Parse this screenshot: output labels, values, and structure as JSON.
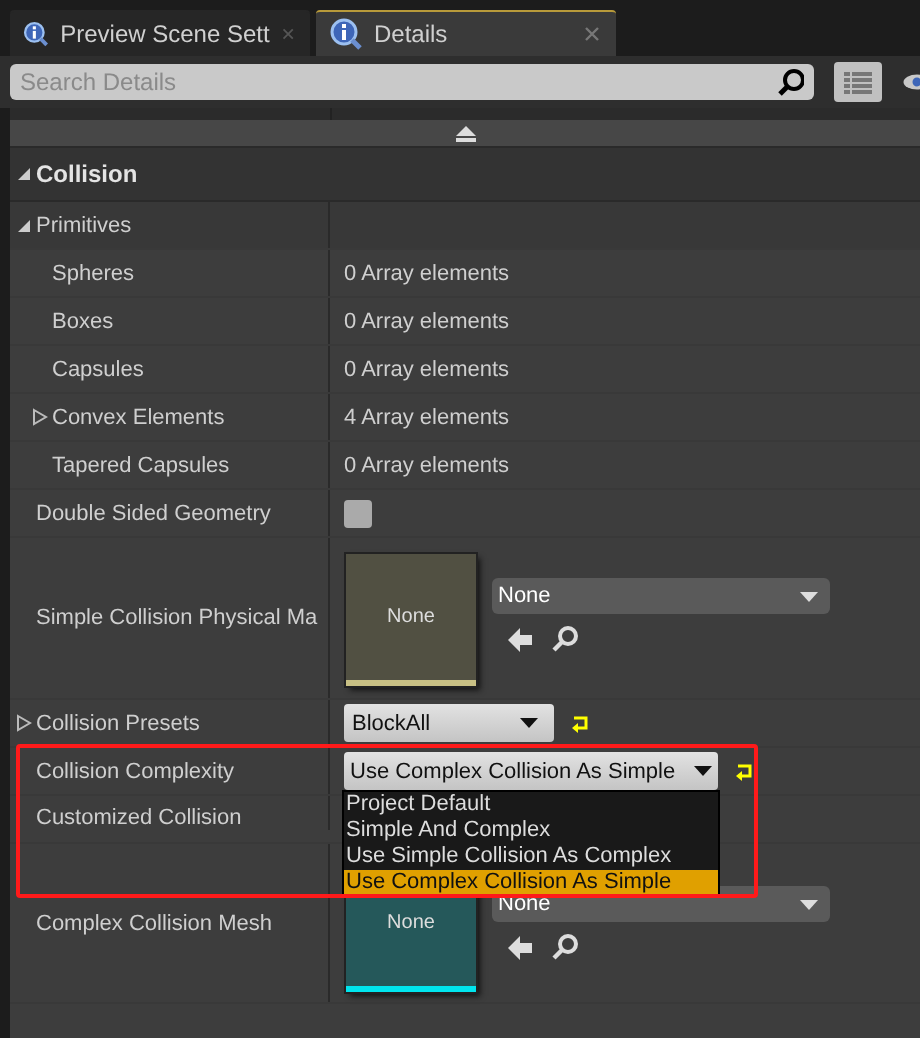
{
  "tabs": [
    {
      "label": "Preview Scene Sett",
      "selected": false
    },
    {
      "label": "Details",
      "selected": true
    }
  ],
  "search": {
    "placeholder": "Search Details"
  },
  "category": {
    "label": "Collision",
    "expanded": true
  },
  "properties": [
    {
      "kind": "group",
      "name": "Primitives",
      "expanded": true,
      "children": [
        {
          "kind": "array",
          "name": "Spheres",
          "value": "0 Array elements"
        },
        {
          "kind": "array",
          "name": "Boxes",
          "value": "0 Array elements"
        },
        {
          "kind": "array",
          "name": "Capsules",
          "value": "0 Array elements"
        },
        {
          "kind": "array",
          "name": "Convex Elements",
          "value": "4 Array elements",
          "expanded": false
        },
        {
          "kind": "array",
          "name": "Tapered Capsules",
          "value": "0 Array elements"
        }
      ]
    },
    {
      "kind": "checkbox",
      "name": "Double Sided Geometry",
      "checked": false
    },
    {
      "kind": "asset",
      "name": "Simple Collision Physical Ma",
      "thumb": "None",
      "color": "#c8c084",
      "value": "None"
    },
    {
      "kind": "combo",
      "name": "Collision Presets",
      "expanded": false,
      "value": "BlockAll",
      "reset": true
    },
    {
      "kind": "combo",
      "name": "Collision Complexity",
      "value": "Use Complex Collision As Simple",
      "reset": true,
      "menu": [
        {
          "label": "Project Default",
          "selected": false
        },
        {
          "label": "Simple And Complex",
          "selected": false
        },
        {
          "label": "Use Simple Collision As Complex",
          "selected": false
        },
        {
          "label": "Use Complex Collision As Simple",
          "selected": true
        }
      ]
    },
    {
      "kind": "label",
      "name": "Customized Collision"
    },
    {
      "kind": "asset",
      "name": "Complex Collision Mesh",
      "thumb": "None",
      "color": "#00e5ee",
      "value": "None"
    }
  ]
}
